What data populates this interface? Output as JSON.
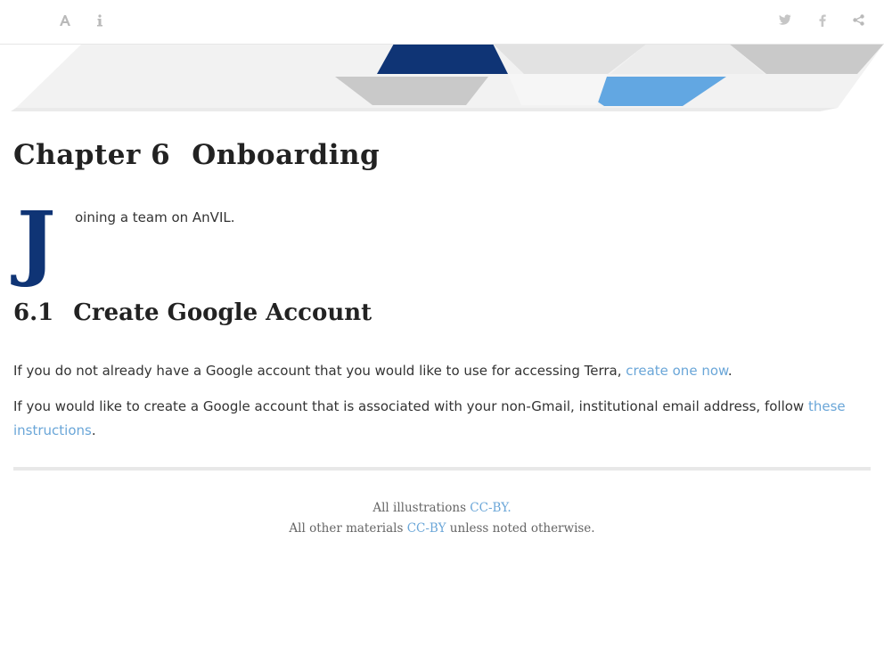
{
  "toolbar": {
    "left_icons": [
      "font-settings-icon",
      "info-icon"
    ],
    "right_icons": [
      "twitter-icon",
      "facebook-icon",
      "share-icon"
    ]
  },
  "banner": {
    "colors": {
      "navy": "#0f3475",
      "light_blue": "#62a7e2",
      "gray": "#c9c9c9",
      "light_gray": "#e5e5e5",
      "pale": "#f1f1f1"
    }
  },
  "chapter": {
    "number": "Chapter 6",
    "title": "Onboarding"
  },
  "intro": {
    "dropcap": "J",
    "rest": "oining a team on AnVIL."
  },
  "section": {
    "number": "6.1",
    "title": "Create Google Account"
  },
  "paragraphs": {
    "p1": {
      "text": "If you do not already have a Google account that you would like to use for accessing Terra, ",
      "link": "create one now",
      "after": "."
    },
    "p2": {
      "text": "If you would like to create a Google account that is associated with your non-Gmail, institutional email address, follow ",
      "link": "these instructions",
      "after": "."
    }
  },
  "footer": {
    "line1_text": "All illustrations ",
    "line1_link": "CC-BY.",
    "line2_text": "All other materials ",
    "line2_link": "CC-BY",
    "line2_after": " unless noted otherwise."
  },
  "accent_color": "#0f3475",
  "link_color": "#6aa6d8"
}
